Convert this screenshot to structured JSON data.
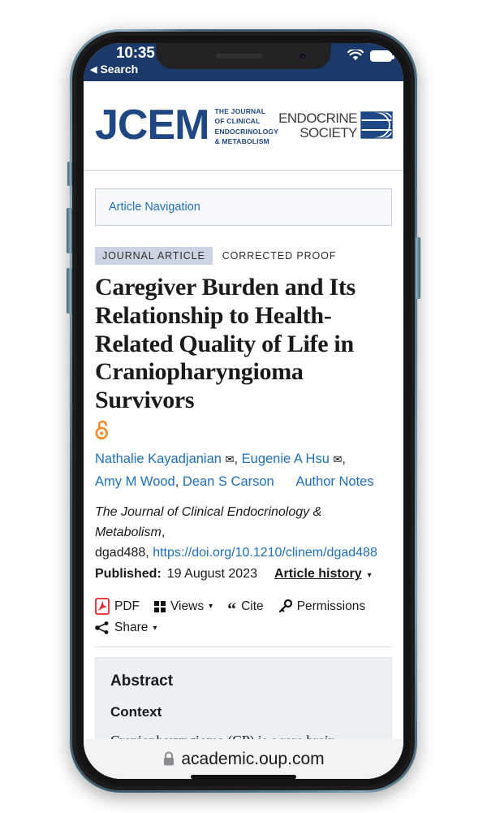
{
  "status_bar": {
    "time": "10:35",
    "back_label": "Search",
    "back_caret": "◀",
    "wifi_icon": "wifi-icon",
    "battery_icon": "battery-full-icon"
  },
  "journal_header": {
    "mark": "JCEM",
    "subtitle_lines": [
      "The Journal",
      "of Clinical",
      "Endocrinology",
      "& Metabolism"
    ],
    "society_line1": "ENDOCRINE",
    "society_line2": "SOCIETY",
    "society_logo_icon": "endocrine-society-globe-icon"
  },
  "article_navigation": {
    "label": "Article Navigation"
  },
  "tags": {
    "type": "JOURNAL ARTICLE",
    "status": "CORRECTED PROOF"
  },
  "article": {
    "title": "Caregiver Burden and Its Relationship to Health-Related Quality of Life in Craniopharyngioma Survivors",
    "open_access_icon": "open-access-unlock-icon",
    "authors": [
      {
        "name": "Nathalie Kayadjanian",
        "has_email": true
      },
      {
        "name": "Eugenie A Hsu",
        "has_email": true
      },
      {
        "name": "Amy M Wood",
        "has_email": false
      },
      {
        "name": "Dean S Carson",
        "has_email": false
      }
    ],
    "author_notes_label": "Author Notes",
    "journal_name": "The Journal of Clinical Endocrinology & Metabolism",
    "article_id": "dgad488",
    "doi_url": "https://doi.org/10.1210/clinem/dgad488",
    "published_label": "Published:",
    "published_date": "19 August 2023",
    "article_history_label": "Article history",
    "article_history_caret": "▾"
  },
  "toolbar": {
    "items": [
      {
        "label": "PDF",
        "icon": "pdf-file-icon",
        "caret": ""
      },
      {
        "label": "Views",
        "icon": "views-grid-icon",
        "caret": "▾"
      },
      {
        "label": "Cite",
        "icon": "quote-icon",
        "caret": ""
      },
      {
        "label": "Permissions",
        "icon": "key-icon",
        "caret": ""
      },
      {
        "label": "Share",
        "icon": "share-nodes-icon",
        "caret": "▾"
      }
    ]
  },
  "abstract": {
    "heading": "Abstract",
    "subheading": "Context",
    "body": "Craniopharyngioma (CP) is a rare brain"
  },
  "browser": {
    "url": "academic.oup.com",
    "lock_icon": "lock-icon"
  },
  "colors": {
    "status_bar_bg": "#1c3a69",
    "jcem_blue": "#1e4784",
    "link_blue": "#1f6fb8",
    "open_access_orange": "#f08c23",
    "pdf_red": "#e8262b",
    "tag_pill_bg": "#ccd4e4",
    "abstract_bg": "#eceff4"
  }
}
